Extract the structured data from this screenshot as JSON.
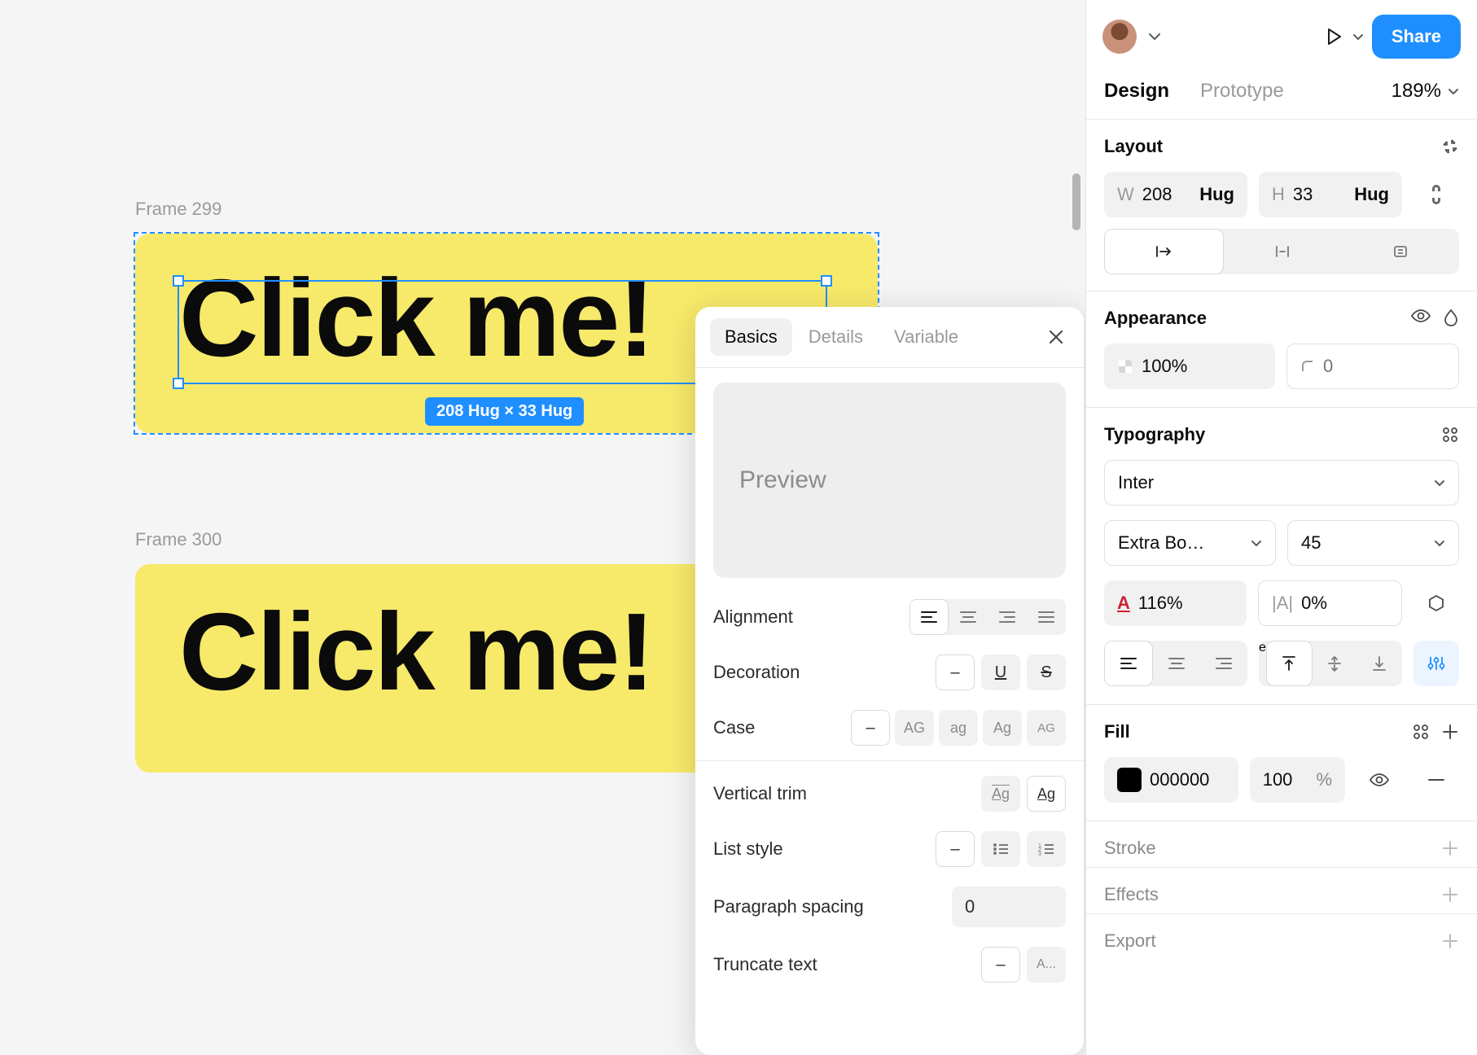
{
  "canvas": {
    "frame1_label": "Frame 299",
    "frame2_label": "Frame 300",
    "text": "Click me!",
    "dim_badge": "208 Hug × 33 Hug"
  },
  "popover": {
    "tabs": {
      "basics": "Basics",
      "details": "Details",
      "variable": "Variable"
    },
    "preview": "Preview",
    "alignment": "Alignment",
    "decoration": "Decoration",
    "case_label": "Case",
    "case_opts": {
      "none": "–",
      "upper": "AG",
      "lower": "ag",
      "title": "Ag",
      "small": "AG"
    },
    "vertical_trim": "Vertical trim",
    "vtrim_opts": {
      "std": "Ag",
      "cap": "Ag"
    },
    "list_style": "List style",
    "paragraph_spacing": "Paragraph spacing",
    "paragraph_value": "0",
    "truncate": "Truncate text",
    "truncate_opts": {
      "none": "–",
      "end": "A..."
    },
    "deco_none": "–"
  },
  "rpanel": {
    "share": "Share",
    "tabs": {
      "design": "Design",
      "prototype": "Prototype"
    },
    "zoom": "189%",
    "layout": {
      "title": "Layout",
      "w_label": "W",
      "w_value": "208",
      "w_mode": "Hug",
      "h_label": "H",
      "h_value": "33",
      "h_mode": "Hug"
    },
    "appearance": {
      "title": "Appearance",
      "opacity": "100%",
      "radius_ph": "0"
    },
    "typography": {
      "title": "Typography",
      "font": "Inter",
      "weight": "Extra Bo…",
      "size": "45",
      "lineheight": "116%",
      "letterspacing": "0%"
    },
    "fill": {
      "title": "Fill",
      "hex": "000000",
      "alpha": "100",
      "pct": "%"
    },
    "stroke": "Stroke",
    "effects": "Effects",
    "export": "Export"
  }
}
